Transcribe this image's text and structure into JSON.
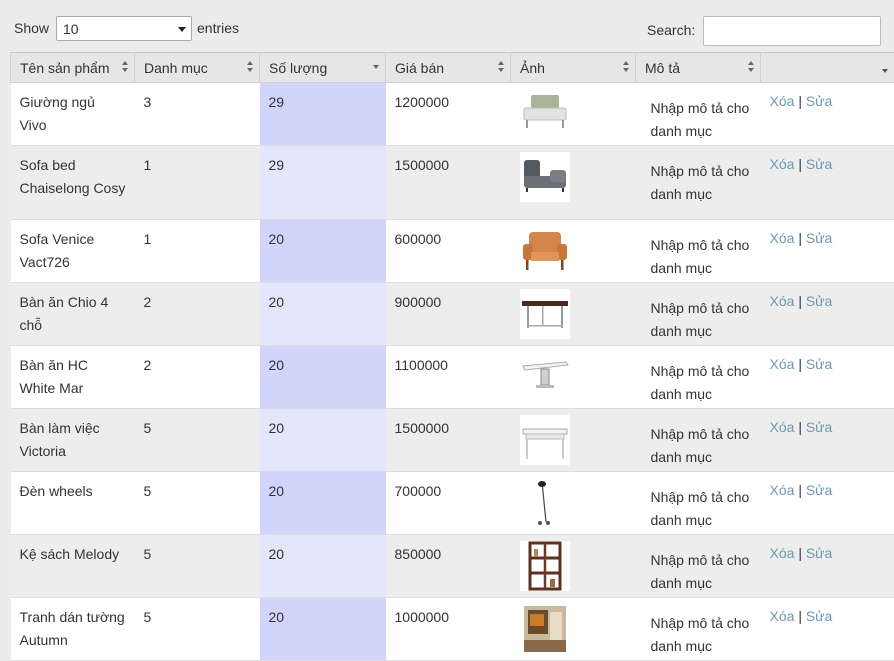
{
  "length_menu": {
    "show_label": "Show",
    "selected": "10",
    "entries_label": "entries"
  },
  "search": {
    "label": "Search:",
    "value": ""
  },
  "columns": [
    "Tên sản phẩm",
    "Danh mục",
    "Số lượng",
    "Giá bán",
    "Ảnh",
    "Mô tả",
    ""
  ],
  "rows": [
    {
      "name": "Giường ngủ Vivo",
      "category": "3",
      "quantity": "29",
      "price": "1200000",
      "image": "bed-image",
      "desc": "Nhập mô tả cho danh mục",
      "delete": "Xóa",
      "sep": "|",
      "edit": "Sửa"
    },
    {
      "name": "Sofa bed Chaiselong Cosy",
      "category": "1",
      "quantity": "29",
      "price": "1500000",
      "image": "sofa-bed-image",
      "desc": "Nhập mô tả cho danh mục",
      "delete": "Xóa",
      "sep": "|",
      "edit": "Sửa"
    },
    {
      "name": "Sofa Venice Vact726",
      "category": "1",
      "quantity": "20",
      "price": "600000",
      "image": "armchair-image",
      "desc": "Nhập mô tả cho danh mục",
      "delete": "Xóa",
      "sep": "|",
      "edit": "Sửa"
    },
    {
      "name": "Bàn ăn Chio 4 chỗ",
      "category": "2",
      "quantity": "20",
      "price": "900000",
      "image": "dining-table-image",
      "desc": "Nhập mô tả cho danh mục",
      "delete": "Xóa",
      "sep": "|",
      "edit": "Sửa"
    },
    {
      "name": "Bàn ăn HC White Mar",
      "category": "2",
      "quantity": "20",
      "price": "1100000",
      "image": "white-table-image",
      "desc": "Nhập mô tả cho danh mục",
      "delete": "Xóa",
      "sep": "|",
      "edit": "Sửa"
    },
    {
      "name": "Bàn làm việc Victoria",
      "category": "5",
      "quantity": "20",
      "price": "1500000",
      "image": "desk-image",
      "desc": "Nhập mô tả cho danh mục",
      "delete": "Xóa",
      "sep": "|",
      "edit": "Sửa"
    },
    {
      "name": "Đèn wheels",
      "category": "5",
      "quantity": "20",
      "price": "700000",
      "image": "lamp-image",
      "desc": "Nhập mô tả cho danh mục",
      "delete": "Xóa",
      "sep": "|",
      "edit": "Sửa"
    },
    {
      "name": "Kệ sách Melody",
      "category": "5",
      "quantity": "20",
      "price": "850000",
      "image": "bookshelf-image",
      "desc": "Nhập mô tả cho danh mục",
      "delete": "Xóa",
      "sep": "|",
      "edit": "Sửa"
    },
    {
      "name": "Tranh dán tường Autumn",
      "category": "5",
      "quantity": "20",
      "price": "1000000",
      "image": "wall-art-image",
      "desc": "Nhập mô tả cho danh mục",
      "delete": "Xóa",
      "sep": "|",
      "edit": "Sửa"
    }
  ],
  "colors": {
    "sorted_odd": "#d2d5fb",
    "sorted_even": "#e4e6fc",
    "link": "#6e98b2"
  }
}
